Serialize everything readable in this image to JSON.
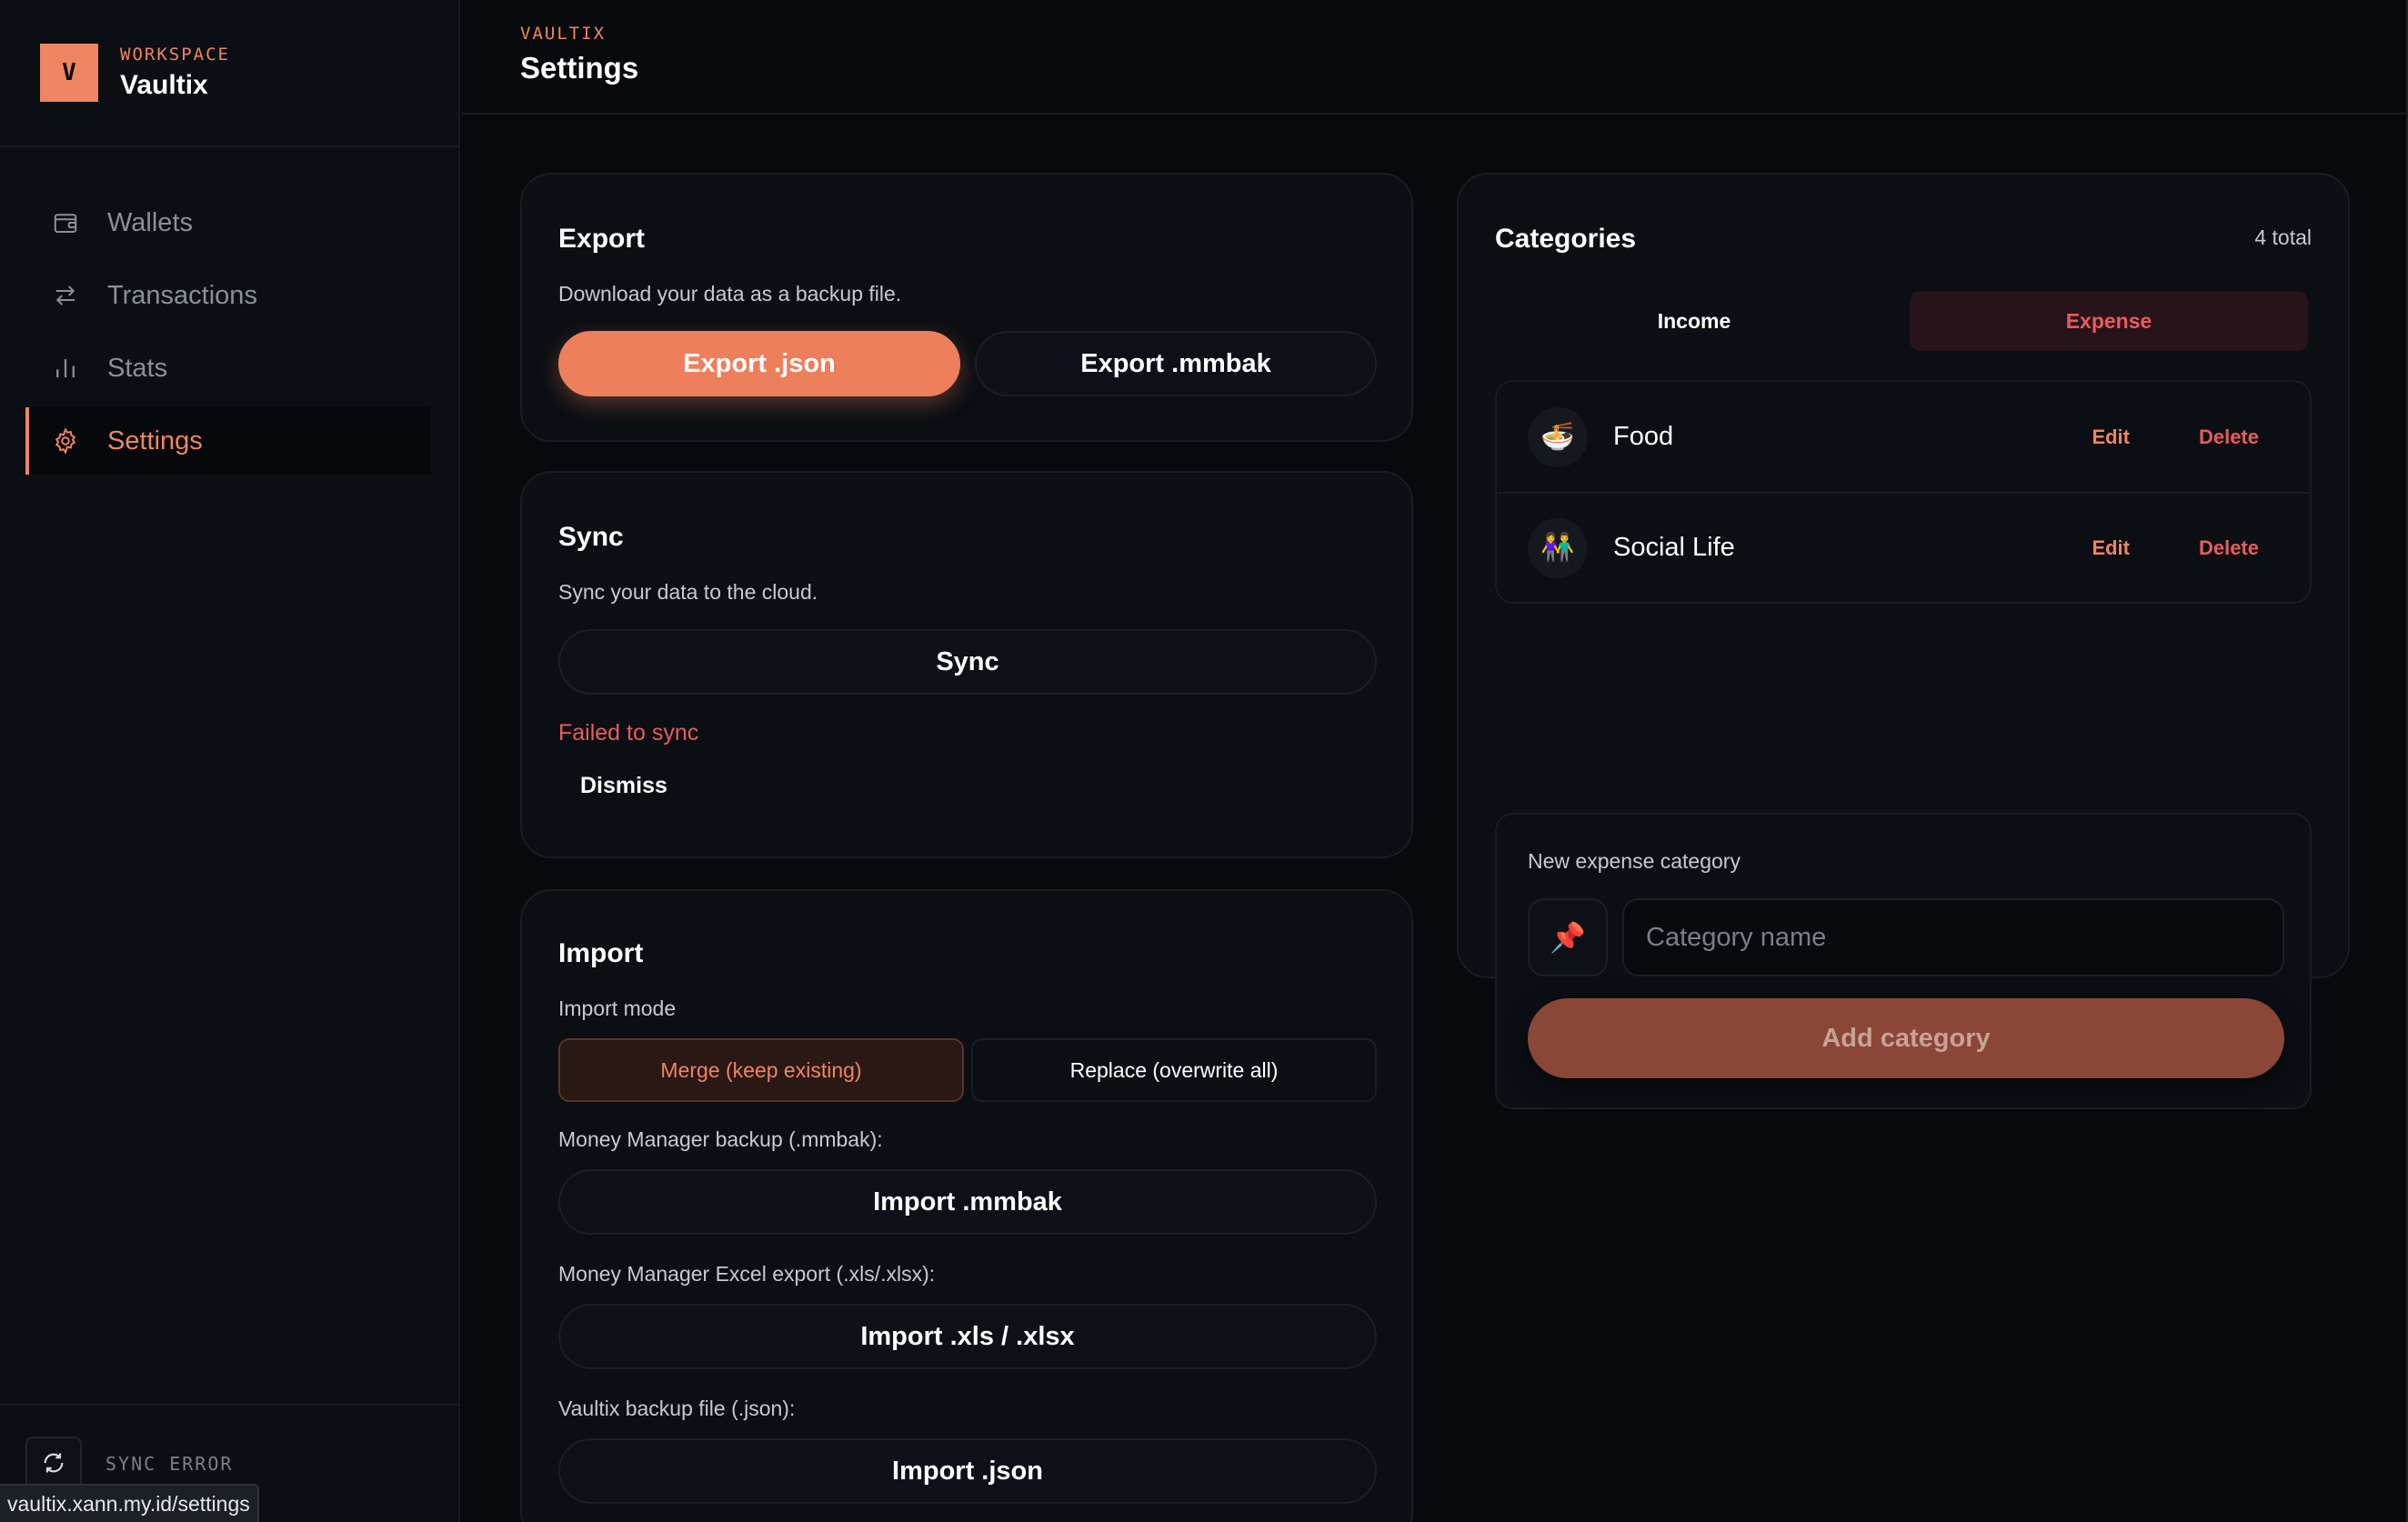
{
  "brand": {
    "kicker": "WORKSPACE",
    "name": "Vaultix",
    "logo_letter": "V"
  },
  "nav": [
    {
      "label": "Wallets",
      "icon": "wallet-icon"
    },
    {
      "label": "Transactions",
      "icon": "arrows-icon"
    },
    {
      "label": "Stats",
      "icon": "bar-chart-icon"
    },
    {
      "label": "Settings",
      "icon": "gear-icon",
      "active": true
    }
  ],
  "footer": {
    "sync_status": "SYNC ERROR",
    "url": "vaultix.xann.my.id/settings"
  },
  "header": {
    "crumb": "VAULTIX",
    "title": "Settings"
  },
  "export": {
    "title": "Export",
    "desc": "Download your data as a backup file.",
    "json_label": "Export .json",
    "mmbak_label": "Export .mmbak"
  },
  "sync": {
    "title": "Sync",
    "desc": "Sync your data to the cloud.",
    "button_label": "Sync",
    "error": "Failed to sync",
    "dismiss": "Dismiss"
  },
  "import": {
    "title": "Import",
    "mode_label": "Import mode",
    "mode_merge": "Merge (keep existing)",
    "mode_replace": "Replace (overwrite all)",
    "mmbak_label": "Money Manager backup (.mmbak):",
    "mmbak_button": "Import .mmbak",
    "xls_label": "Money Manager Excel export (.xls/.xlsx):",
    "xls_button": "Import .xls / .xlsx",
    "json_label": "Vaultix backup file (.json):",
    "json_button": "Import .json"
  },
  "categories": {
    "title": "Categories",
    "count": "4 total",
    "tab_income": "Income",
    "tab_expense": "Expense",
    "items": [
      {
        "emoji": "🍜",
        "name": "Food",
        "edit": "Edit",
        "delete": "Delete"
      },
      {
        "emoji": "👫",
        "name": "Social Life",
        "edit": "Edit",
        "delete": "Delete"
      }
    ],
    "new_label": "New expense category",
    "new_emoji": "📌",
    "new_placeholder": "Category name",
    "add_button": "Add category"
  },
  "colors": {
    "accent": "#ef8562",
    "danger": "#ea5b5b",
    "background": "#07090d"
  }
}
